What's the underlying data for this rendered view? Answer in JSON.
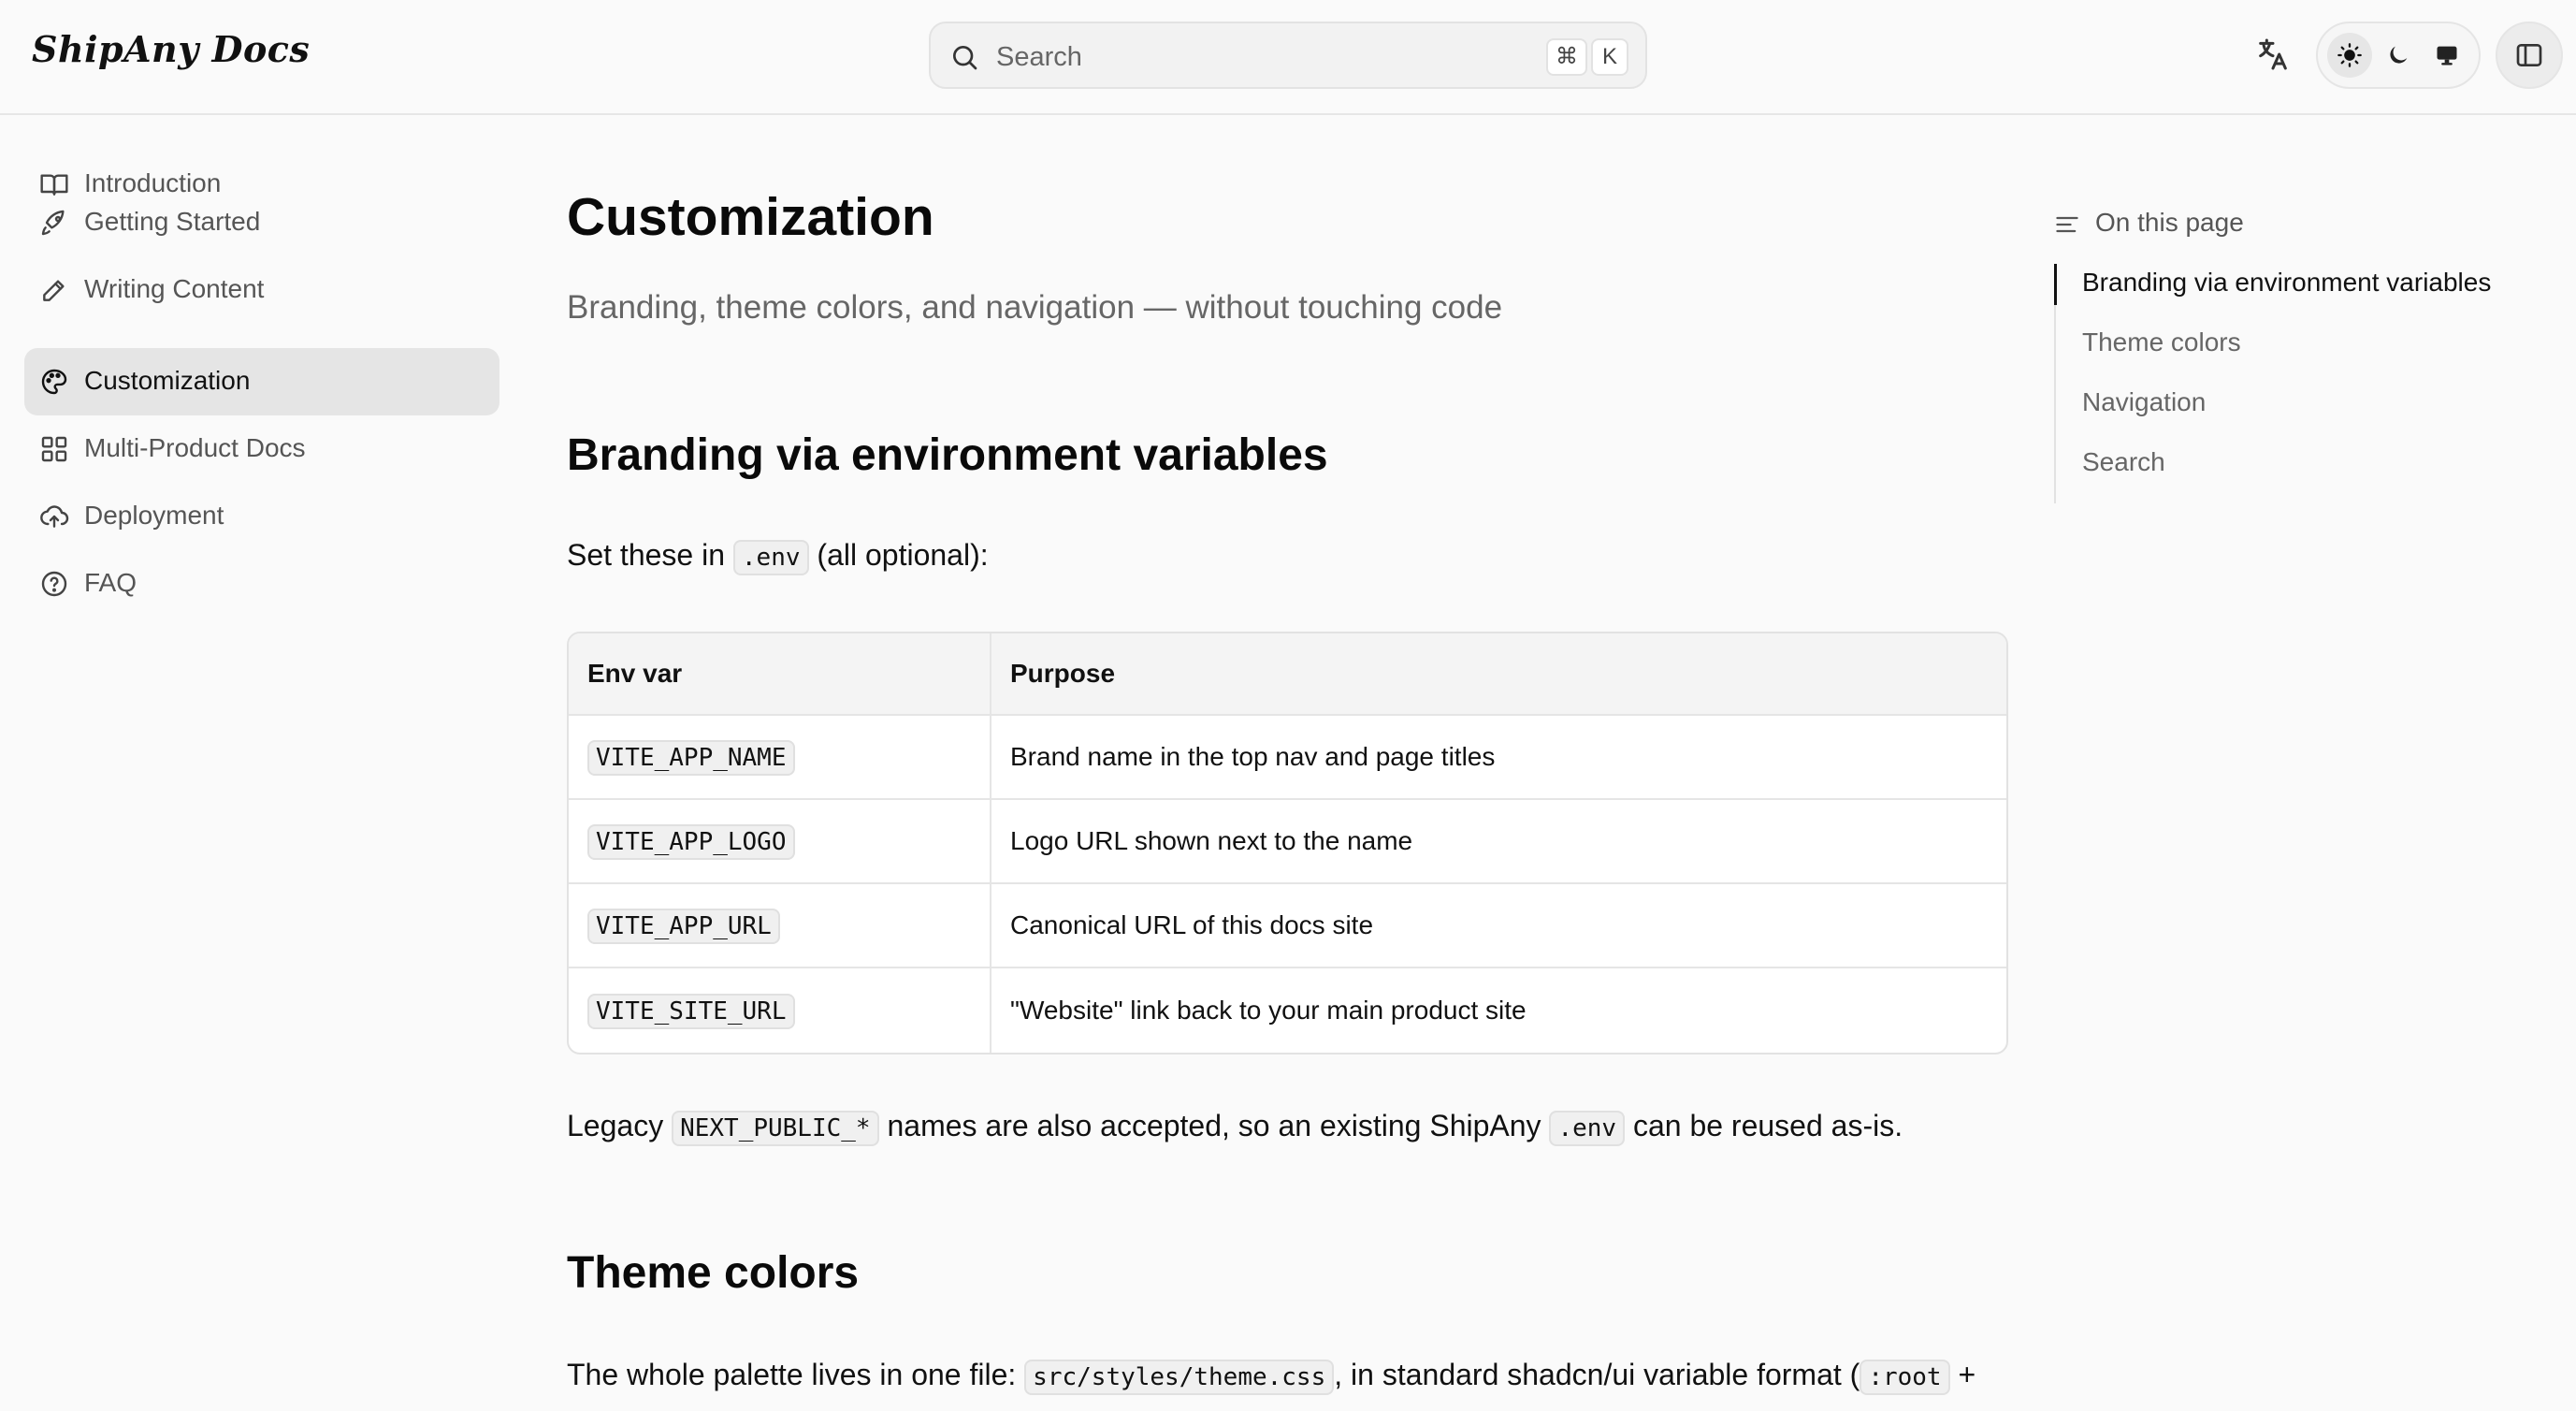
{
  "header": {
    "brand": "ShipAny Docs",
    "search_placeholder": "Search",
    "shortcut_modifier": "⌘",
    "shortcut_key": "K",
    "icons": [
      "translate-icon",
      "sun-icon",
      "moon-icon",
      "monitor-icon",
      "sidebar-toggle-icon"
    ],
    "theme_selected": "light"
  },
  "sidebar": {
    "items": [
      {
        "label": "Introduction",
        "icon": "book-icon"
      },
      {
        "label": "Getting Started",
        "icon": "rocket-icon"
      },
      {
        "label": "Writing Content",
        "icon": "pencil-icon"
      },
      {
        "label": "Customization",
        "icon": "palette-icon",
        "active": true
      },
      {
        "label": "Multi-Product Docs",
        "icon": "grid-icon"
      },
      {
        "label": "Deployment",
        "icon": "cloud-upload-icon"
      },
      {
        "label": "FAQ",
        "icon": "help-circle-icon"
      }
    ]
  },
  "main": {
    "title": "Customization",
    "subtitle": "Branding, theme colors, and navigation — without touching code",
    "section1": {
      "heading": "Branding via environment variables",
      "intro_before": "Set these in",
      "intro_code": ".env",
      "intro_after": "(all optional):",
      "table": {
        "headers": [
          "Env var",
          "Purpose"
        ],
        "rows": [
          {
            "var": "VITE_APP_NAME",
            "purpose": "Brand name in the top nav and page titles"
          },
          {
            "var": "VITE_APP_LOGO",
            "purpose": "Logo URL shown next to the name"
          },
          {
            "var": "VITE_APP_URL",
            "purpose": "Canonical URL of this docs site"
          },
          {
            "var": "VITE_SITE_URL",
            "purpose": "\"Website\" link back to your main product site"
          }
        ]
      },
      "legacy_before": "Legacy",
      "legacy_code": "NEXT_PUBLIC_*",
      "legacy_middle": "names are also accepted, so an existing ShipAny",
      "legacy_code2": ".env",
      "legacy_after": "can be reused as-is."
    },
    "section2": {
      "heading": "Theme colors",
      "para_before": "The whole palette lives in one file:",
      "para_code": "src/styles/theme.css",
      "para_middle": ", in standard shadcn/ui variable format (",
      "para_code2": ":root",
      "para_after": "+"
    }
  },
  "toc": {
    "heading": "On this page",
    "items": [
      {
        "label": "Branding via environment variables",
        "active": true
      },
      {
        "label": "Theme colors"
      },
      {
        "label": "Navigation"
      },
      {
        "label": "Search"
      }
    ]
  }
}
